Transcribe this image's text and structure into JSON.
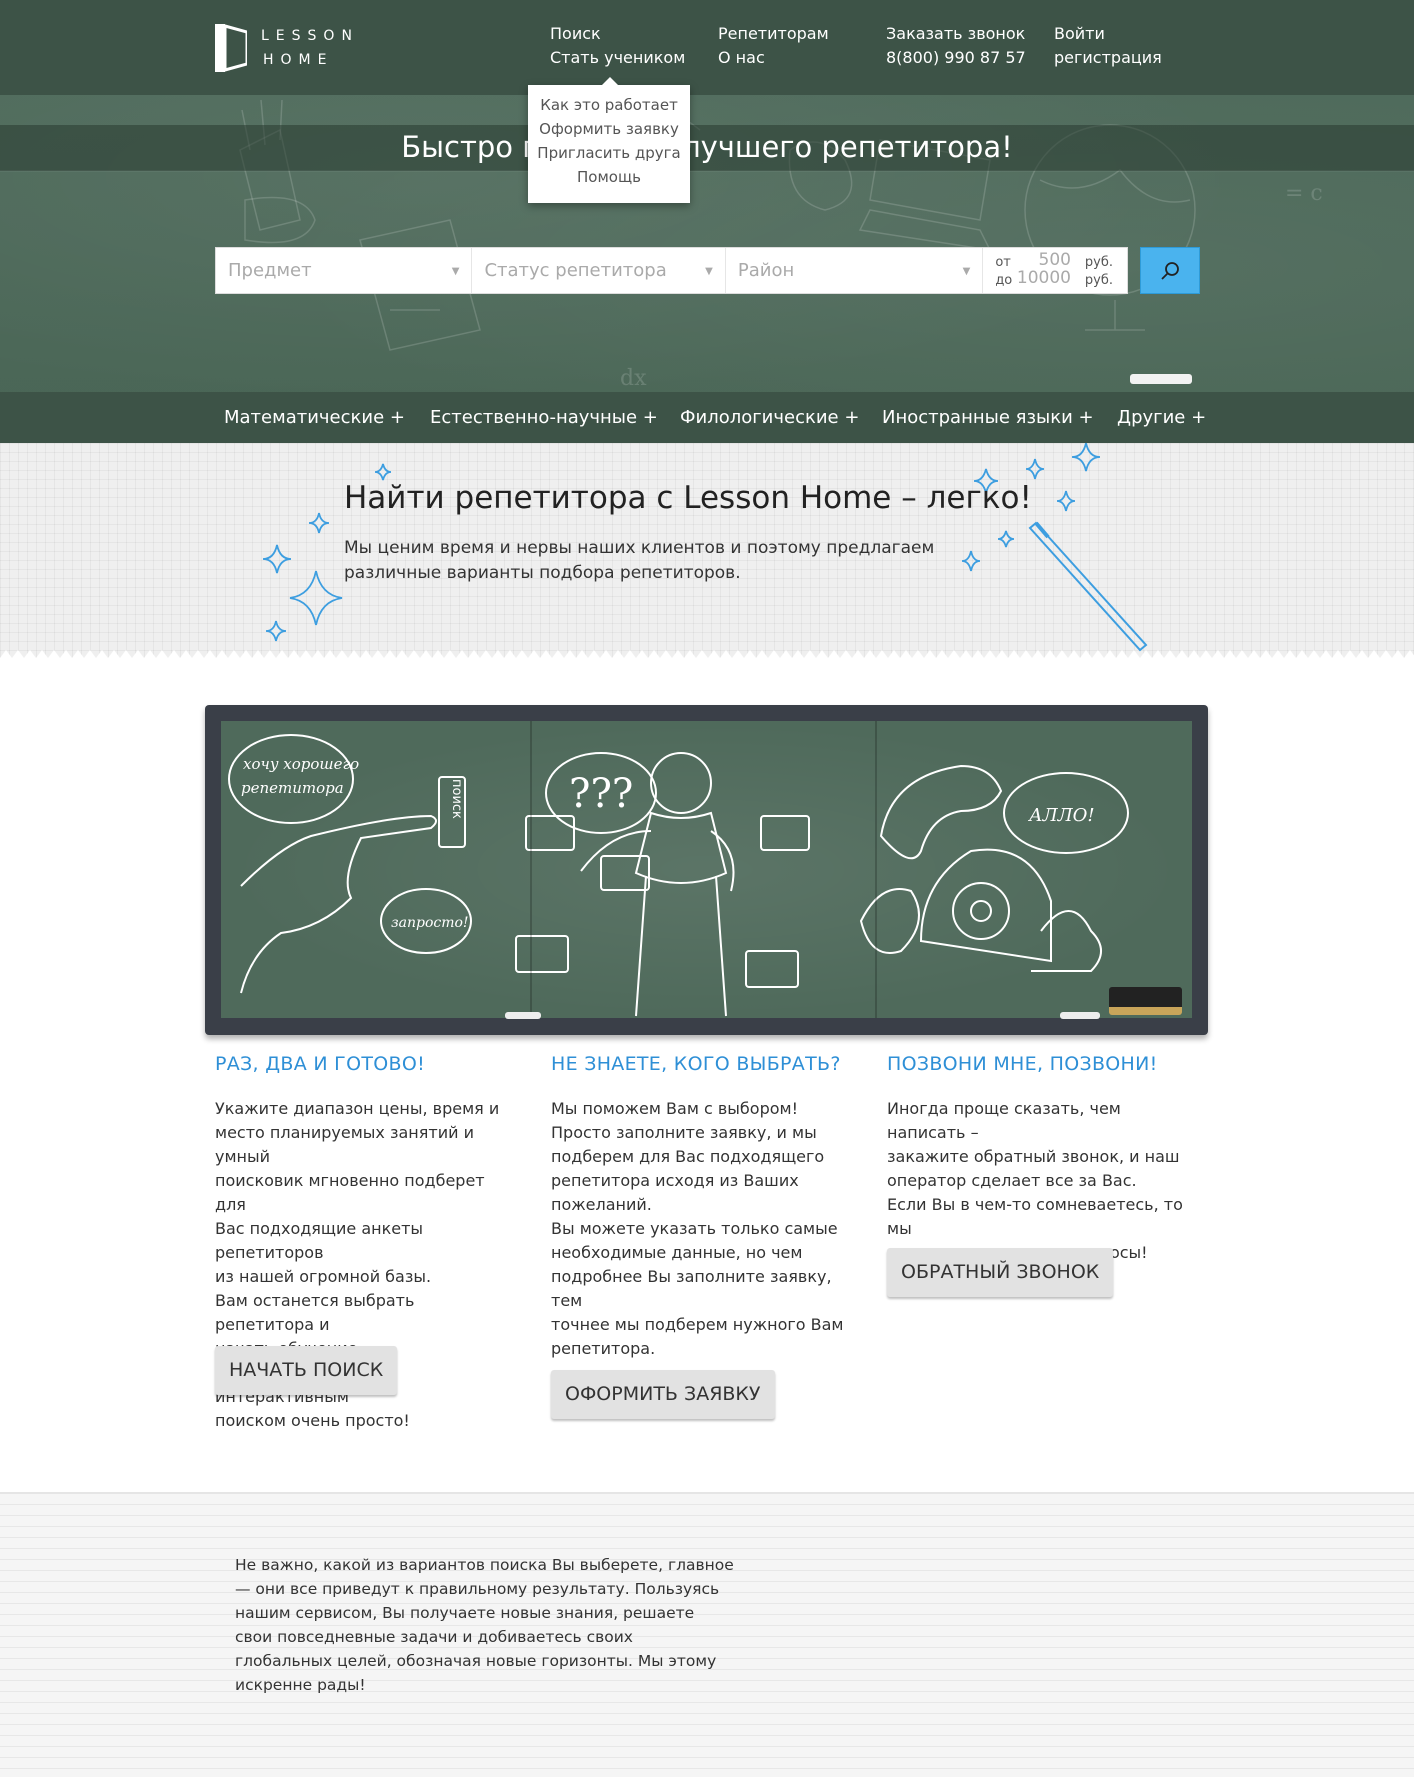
{
  "header": {
    "logo_line1": "LESSON",
    "logo_line2": "HOME",
    "nav": [
      {
        "top": "Поиск",
        "bottom": "Стать учеником"
      },
      {
        "top": "Репетиторам",
        "bottom": "О нас"
      },
      {
        "top": "Заказать звонок",
        "bottom": "8(800) 990 87 57"
      },
      {
        "top": "Войти",
        "bottom": "регистрация"
      }
    ],
    "dropdown": [
      "Как это работает",
      "Оформить заявку",
      "Пригласить друга",
      "Помощь"
    ]
  },
  "hero": {
    "title": "Быстро подберем лучшего репетитора!",
    "search": {
      "subject_placeholder": "Предмет",
      "status_placeholder": "Статус репетитора",
      "district_placeholder": "Район",
      "from_label": "от",
      "to_label": "до",
      "from_value": "500",
      "to_value": "10000",
      "currency": "руб."
    }
  },
  "categories": [
    "Математические +",
    "Естественно-научные +",
    "Филологические +",
    "Иностранные языки +",
    "Другие +"
  ],
  "intro": {
    "title": "Найти репетитора с Lesson Home – легко!",
    "text": "Мы ценим время и нервы наших клиентов и поэтому предлагаем различные варианты подбора репетиторов."
  },
  "board": {
    "bubble1": "хочу хорошего репетитора",
    "search_tag": "поиск",
    "bubble2": "запросто!",
    "bubble3": "алло!"
  },
  "features": [
    {
      "title": "РАЗ, ДВА И ГОТОВО!",
      "text": "Укажите  диапазон цены, время и\nместо планируемых занятий и умный\nпоисковик мгновенно подберет для\nВас подходящие анкеты репетиторов\nиз нашей огромной базы.\nВам останется выбрать репетитора и\nначать обучение.\nПользоваться нашим интерактивным\nпоиском очень просто!",
      "button": "НАЧАТЬ ПОИСК"
    },
    {
      "title": "НЕ ЗНАЕТЕ, КОГО ВЫБРАТЬ?",
      "text": "Мы поможем Вам с выбором!\nПросто заполните заявку, и мы\nподберем для Вас подходящего\nрепетитора исходя из Ваших\nпожеланий.\nВы можете указать только самые\nнеобходимые данные, но чем\nподробнее Вы заполните заявку, тем\nточнее мы подберем нужного Вам\nрепетитора.",
      "button": "ОФОРМИТЬ ЗАЯВКУ"
    },
    {
      "title": "ПОЗВОНИ МНЕ, ПОЗВОНИ!",
      "text": "Иногда проще сказать, чем написать –\nзакажите обратный звонок, и наш\nоператор сделает все за Вас.\nЕсли Вы в чем-то сомневаетесь, то мы\nответим на все ваши вопросы!",
      "button": "ОБРАТНЫЙ ЗВОНОК"
    }
  ],
  "footer_text": "Не важно, какой из вариантов поиска Вы выберете, главное — они все приведут к правильному результату. Пользуясь нашим сервисом, Вы получаете новые знания, решаете свои повседневные задачи и добиваетесь своих глобальных целей, обозначая новые горизонты. Мы этому искренне рады!",
  "colors": {
    "accent": "#2e8fd6",
    "search_button": "#4ab3ee",
    "chalkboard": "#4a6656",
    "topbar": "#3d5347"
  }
}
